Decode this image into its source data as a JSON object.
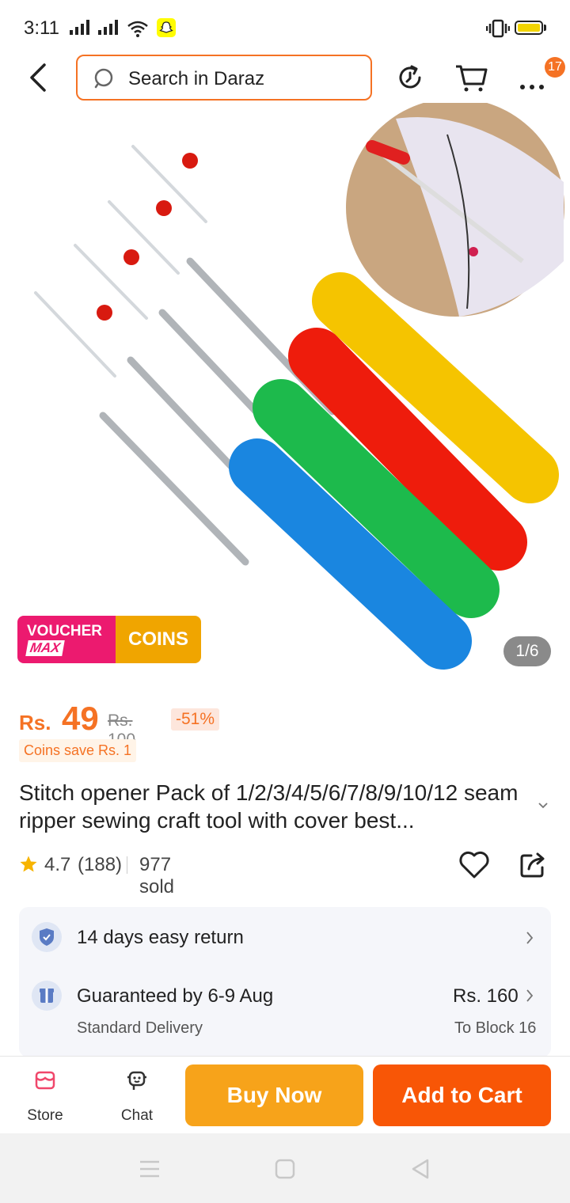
{
  "status_bar": {
    "time": "3:11"
  },
  "header": {
    "search_placeholder": "Search in Daraz",
    "cart_badge": "17",
    "icons": [
      "back-icon",
      "search-icon",
      "history-icon",
      "cart-icon",
      "more-icon"
    ]
  },
  "gallery": {
    "voucher_label_top": "VOUCHER",
    "voucher_label_max": "MAX",
    "voucher_coins": "COINS",
    "counter": "1/6"
  },
  "price": {
    "currency": "Rs.",
    "value": "49",
    "original": "Rs. 100",
    "discount": "-51%",
    "coins_save": "Coins save Rs. 1"
  },
  "product": {
    "title": "Stitch opener Pack of 1/2/3/4/5/6/7/8/9/10/12 seam ripper sewing craft tool with cover best...",
    "rating": "4.7",
    "rating_count": "(188)",
    "sold": "977 sold"
  },
  "services": {
    "return": "14 days easy return",
    "delivery": "Guaranteed by 6-9 Aug",
    "delivery_type": "Standard Delivery",
    "delivery_price": "Rs. 160",
    "delivery_to": "To Block 16"
  },
  "bottom_bar": {
    "store": "Store",
    "chat": "Chat",
    "buy_now": "Buy Now",
    "add_to_cart": "Add to Cart"
  },
  "colors": {
    "accent": "#f57224",
    "buy_now": "#f7a31a",
    "add_to_cart": "#f85606",
    "voucher_pink": "#ec1a6f",
    "voucher_gold": "#f0a500"
  }
}
